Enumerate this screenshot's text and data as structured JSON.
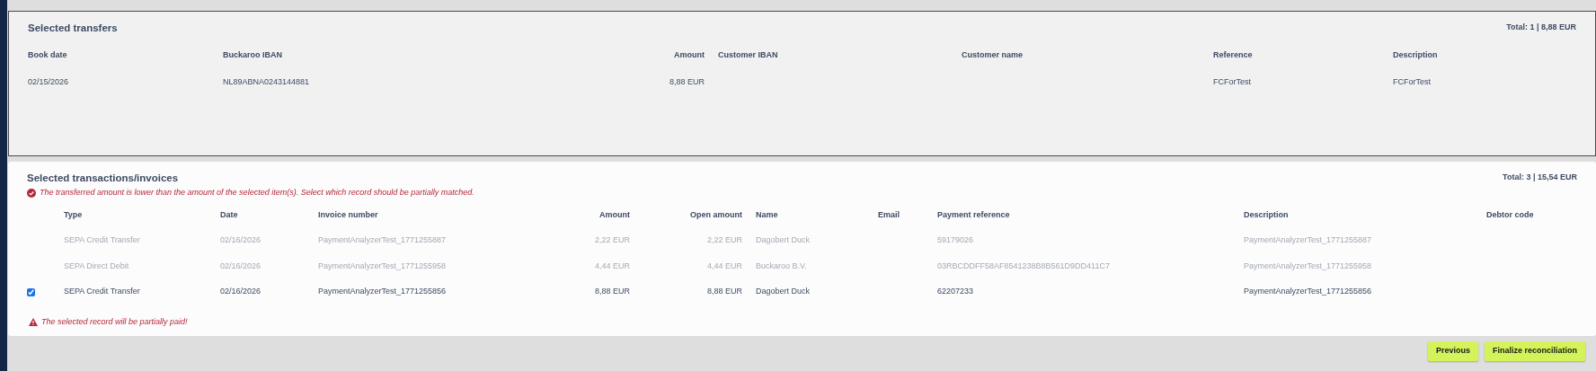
{
  "transfers": {
    "title": "Selected transfers",
    "total": "Total: 1 | 8,88 EUR",
    "columns": [
      "Book date",
      "Buckaroo IBAN",
      "Amount",
      "Customer IBAN",
      "Customer name",
      "Reference",
      "Description"
    ],
    "rows": [
      {
        "book_date": "02/15/2026",
        "buckaroo_iban": "NL89ABNA0243144881",
        "amount": "8,88 EUR",
        "reference": "FCForTest",
        "description": "FCForTest"
      }
    ]
  },
  "transactions": {
    "title": "Selected transactions/invoices",
    "total": "Total: 3 | 15,54 EUR",
    "warning": "The transferred amount is lower than the amount of the selected item(s). Select which record should be partially matched.",
    "columns": [
      "Type",
      "Date",
      "Invoice number",
      "Amount",
      "Open amount",
      "Name",
      "Email",
      "Payment reference",
      "Description",
      "Debtor code"
    ],
    "rows": [
      {
        "selected": false,
        "type": "SEPA Credit Transfer",
        "date": "02/16/2026",
        "invoice_number": "PaymentAnalyzerTest_1771255887",
        "amount": "2,22 EUR",
        "open_amount": "2,22 EUR",
        "name": "Dagobert Duck",
        "payment_reference": "59179026",
        "description": "PaymentAnalyzerTest_1771255887"
      },
      {
        "selected": false,
        "type": "SEPA Direct Debit",
        "date": "02/16/2026",
        "invoice_number": "PaymentAnalyzerTest_1771255958",
        "amount": "4,44 EUR",
        "open_amount": "4,44 EUR",
        "name": "Buckaroo B.V.",
        "payment_reference": "03RBCDDFF58AF8541238B8B561D9DD411C7",
        "description": "PaymentAnalyzerTest_1771255958"
      },
      {
        "selected": true,
        "type": "SEPA Credit Transfer",
        "date": "02/16/2026",
        "invoice_number": "PaymentAnalyzerTest_1771255856",
        "amount": "8,88 EUR",
        "open_amount": "8,88 EUR",
        "name": "Dagobert Duck",
        "payment_reference": "62207233",
        "description": "PaymentAnalyzerTest_1771255856"
      }
    ],
    "partial_notice": "The selected record will be partially paid!"
  },
  "buttons": [
    "Previous",
    "Finalize reconciliation"
  ]
}
